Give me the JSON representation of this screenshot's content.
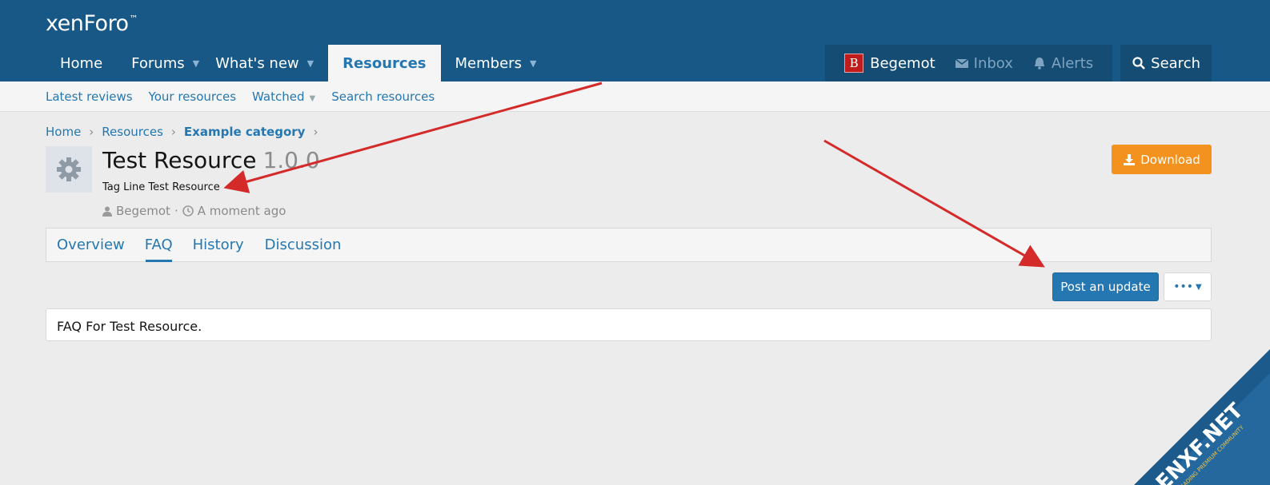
{
  "header": {
    "logo": "xenForo",
    "logo_mark": "™",
    "nav": [
      {
        "label": "Home"
      },
      {
        "label": "Forums"
      },
      {
        "label": "What's new"
      },
      {
        "label": "Resources"
      },
      {
        "label": "Members"
      }
    ],
    "account": {
      "avatar_letter": "B",
      "username": "Begemot",
      "inbox": "Inbox",
      "alerts": "Alerts"
    },
    "search": "Search"
  },
  "subnav": {
    "items": [
      "Latest reviews",
      "Your resources",
      "Watched",
      "Search resources"
    ]
  },
  "breadcrumb": {
    "items": [
      "Home",
      "Resources",
      "Example category"
    ]
  },
  "resource": {
    "icon": "gear-icon",
    "title": "Test Resource",
    "version": "1.0.0",
    "tagline": "Tag Line Test Resource",
    "author": "Begemot",
    "time": "A moment ago",
    "download": "Download"
  },
  "tabs": {
    "items": [
      "Overview",
      "FAQ",
      "History",
      "Discussion"
    ],
    "active": "FAQ"
  },
  "actions": {
    "post_update": "Post an update",
    "more": "•••"
  },
  "content": {
    "text": "FAQ For Test Resource."
  },
  "watermark": {
    "name": "ENXF.NET",
    "tagline": "LEADING PREMIUM COMMUNITY"
  },
  "colors": {
    "header": "#185886",
    "accent": "#2577b1",
    "download": "#f4921f",
    "annotation_arrow": "#d42a2a"
  }
}
